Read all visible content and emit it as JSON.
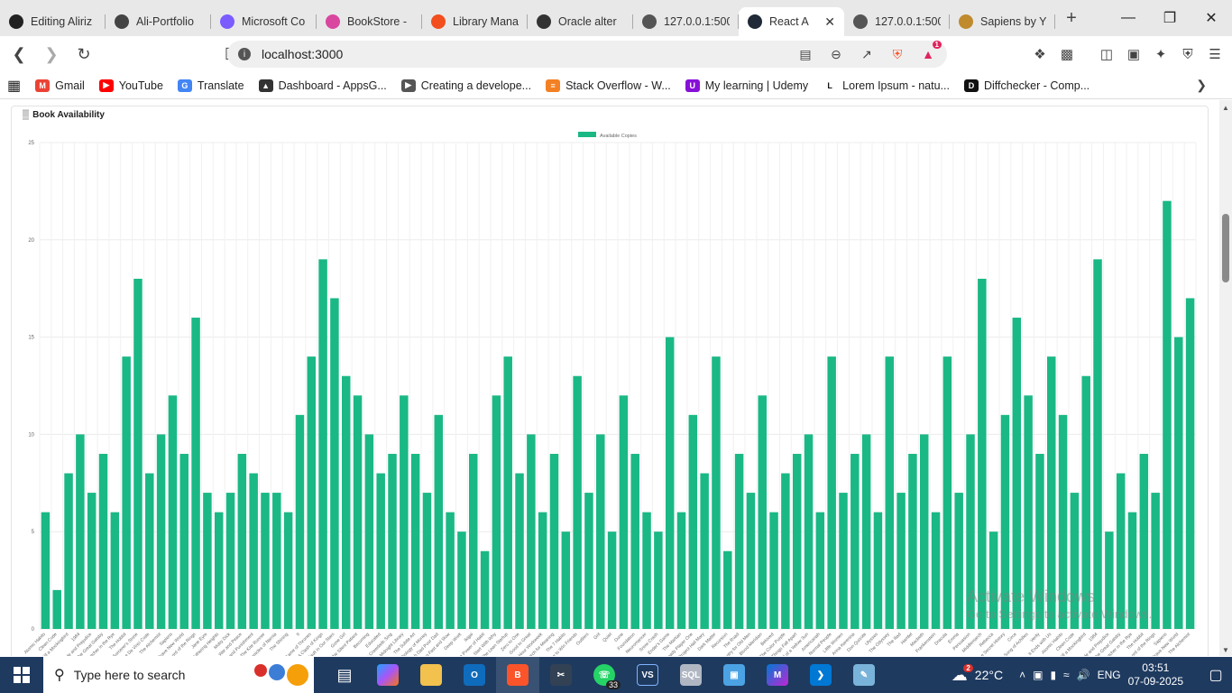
{
  "browser": {
    "tabs": [
      {
        "title": "Editing Aliriz",
        "icon": "github-icon",
        "color": "#222222",
        "active": false
      },
      {
        "title": "Ali-Portfolio",
        "icon": "github-icon",
        "color": "#444444",
        "active": false
      },
      {
        "title": "Microsoft Co",
        "icon": "copilot-icon",
        "color": "#7b5cff",
        "active": false
      },
      {
        "title": "BookStore -",
        "icon": "bookstore-icon",
        "color": "#d946a0",
        "active": false
      },
      {
        "title": "Library Mana",
        "icon": "figma-icon",
        "color": "#f24e1e",
        "active": false
      },
      {
        "title": "Oracle alter",
        "icon": "oracle-icon",
        "color": "#333333",
        "active": false
      },
      {
        "title": "127.0.0.1:500",
        "icon": "globe-icon",
        "color": "#555555",
        "active": false
      },
      {
        "title": "React A",
        "icon": "react-icon",
        "color": "#1f2937",
        "active": true
      },
      {
        "title": "127.0.0.1:500",
        "icon": "globe-icon",
        "color": "#555555",
        "active": false
      },
      {
        "title": "Sapiens by Y",
        "icon": "book-icon",
        "color": "#c08a2e",
        "active": false
      }
    ],
    "url": "localhost:3000",
    "brave_badge": "1",
    "bookmarks": [
      {
        "label": "Gmail",
        "icon": "gmail-icon",
        "color": "#ea4335",
        "glyph": "M"
      },
      {
        "label": "YouTube",
        "icon": "youtube-icon",
        "color": "#ff0000",
        "glyph": "▶"
      },
      {
        "label": "Translate",
        "icon": "translate-icon",
        "color": "#4285f4",
        "glyph": "G"
      },
      {
        "label": "Dashboard - AppsG...",
        "icon": "appsg-icon",
        "color": "#333333",
        "glyph": "▲"
      },
      {
        "label": "Creating a develope...",
        "icon": "dev-icon",
        "color": "#555555",
        "glyph": "▶"
      },
      {
        "label": "Stack Overflow - W...",
        "icon": "stackoverflow-icon",
        "color": "#f48024",
        "glyph": "≡"
      },
      {
        "label": "My learning | Udemy",
        "icon": "udemy-icon",
        "color": "#8710d8",
        "glyph": "U"
      },
      {
        "label": "Lorem Ipsum - natu...",
        "icon": "lorem-icon",
        "color": "#ffffff",
        "glyph": "L"
      },
      {
        "label": "Diffchecker - Comp...",
        "icon": "diffchecker-icon",
        "color": "#111111",
        "glyph": "D"
      }
    ]
  },
  "page": {
    "card_title": "Book Availability"
  },
  "chart_data": {
    "type": "bar",
    "legend": [
      "Available Copies"
    ],
    "legend_position": "top",
    "color": "#1ab885",
    "ylim": [
      0,
      25
    ],
    "yticks": [
      0,
      5,
      10,
      15,
      20,
      25
    ],
    "grid": true,
    "categories": [
      "Atomic Habits",
      "Clean Code",
      "To Kill a Mockingbird",
      "1984",
      "Pride and Prejudice",
      "The Great Gatsby",
      "The Catcher in the Rye",
      "The Hobbit",
      "Harry Potter and the Sorcerer's Stone",
      "The Da Vinci Code",
      "The Alchemist",
      "Sapiens",
      "Brave New World",
      "The Lord of the Rings",
      "Jane Eyre",
      "Wuthering Heights",
      "Moby Dick",
      "War and Peace",
      "Crime and Punishment",
      "The Kite Runner",
      "The Chronicles of Narnia",
      "The Shining",
      "It",
      "A Game of Thrones",
      "A Clash of Kings",
      "The Fault in Our Stars",
      "Gone Girl",
      "The Silent Patient",
      "Becoming",
      "Educated",
      "Where the Crawdads Sing",
      "The Midnight Library",
      "The Subtle Art",
      "The Psychology of Money",
      "Rich Dad Poor Dad",
      "Thinking Fast and Slow",
      "Deep Work",
      "Ikigai",
      "The Power of Habit",
      "Start With Why",
      "The Lean Startup",
      "Zero to One",
      "Good to Great",
      "The 4-Hour Workweek",
      "Man's Search for Meaning",
      "The 7 Habits",
      "How to Win Friends",
      "Outliers",
      "Grit",
      "Quiet",
      "Dune",
      "Foundation",
      "Neuromancer",
      "Snow Crash",
      "Ender's Game",
      "The Martian",
      "Ready Player One",
      "Project Hail Mary",
      "Dark Matter",
      "Recursion",
      "The Road",
      "No Country for Old Men",
      "Blood Meridian",
      "Beloved",
      "The Color Purple",
      "Things Fall Apart",
      "Half of a Yellow Sun",
      "Americanah",
      "Normal People",
      "Little Women",
      "Anna Karenina",
      "Don Quixote",
      "Ulysses",
      "The Odyssey",
      "The Iliad",
      "Hamlet",
      "Macbeth",
      "Frankenstein",
      "Dracula",
      "Emma",
      "Persuasion",
      "Middlemarch",
      "Rebecca",
      "The Secret History",
      "Circe",
      "The Song of Achilles",
      "Verity",
      "It Ends with Us",
      "Atomic Habits",
      "Clean Code",
      "To Kill a Mockingbird",
      "1984",
      "Pride and Prejudice",
      "The Great Gatsby",
      "Catcher in the Rye",
      "The Hobbit",
      "Lord of the Rings",
      "Sapiens",
      "Brave New World",
      "The Alchemist"
    ],
    "values": [
      6,
      2,
      8,
      10,
      7,
      9,
      6,
      14,
      18,
      8,
      10,
      12,
      9,
      16,
      7,
      6,
      7,
      9,
      8,
      7,
      7,
      6,
      11,
      14,
      19,
      17,
      13,
      12,
      10,
      8,
      9,
      12,
      9,
      7,
      11,
      6,
      5,
      9,
      4,
      12,
      14,
      8,
      10,
      6,
      9,
      5,
      13,
      7,
      10,
      5,
      12,
      9,
      6,
      5,
      15,
      6,
      11,
      8,
      14,
      4,
      9,
      7,
      12,
      6,
      8,
      9,
      10,
      6,
      14,
      7,
      9,
      10,
      6,
      14,
      7,
      9,
      10,
      6,
      14,
      7,
      10,
      18,
      5,
      11,
      16,
      12,
      9,
      14,
      11,
      7,
      13,
      19,
      5,
      8,
      6,
      9,
      7,
      22,
      15,
      17
    ]
  },
  "watermark": {
    "line1": "Activate Windows",
    "line2": "Go to Settings to activate Windows."
  },
  "taskbar": {
    "search_placeholder": "Type here to search",
    "whatsapp_badge": "33",
    "weather_badge": "2",
    "temperature": "22°C",
    "language": "ENG",
    "time": "03:51",
    "date": "07-09-2025"
  }
}
